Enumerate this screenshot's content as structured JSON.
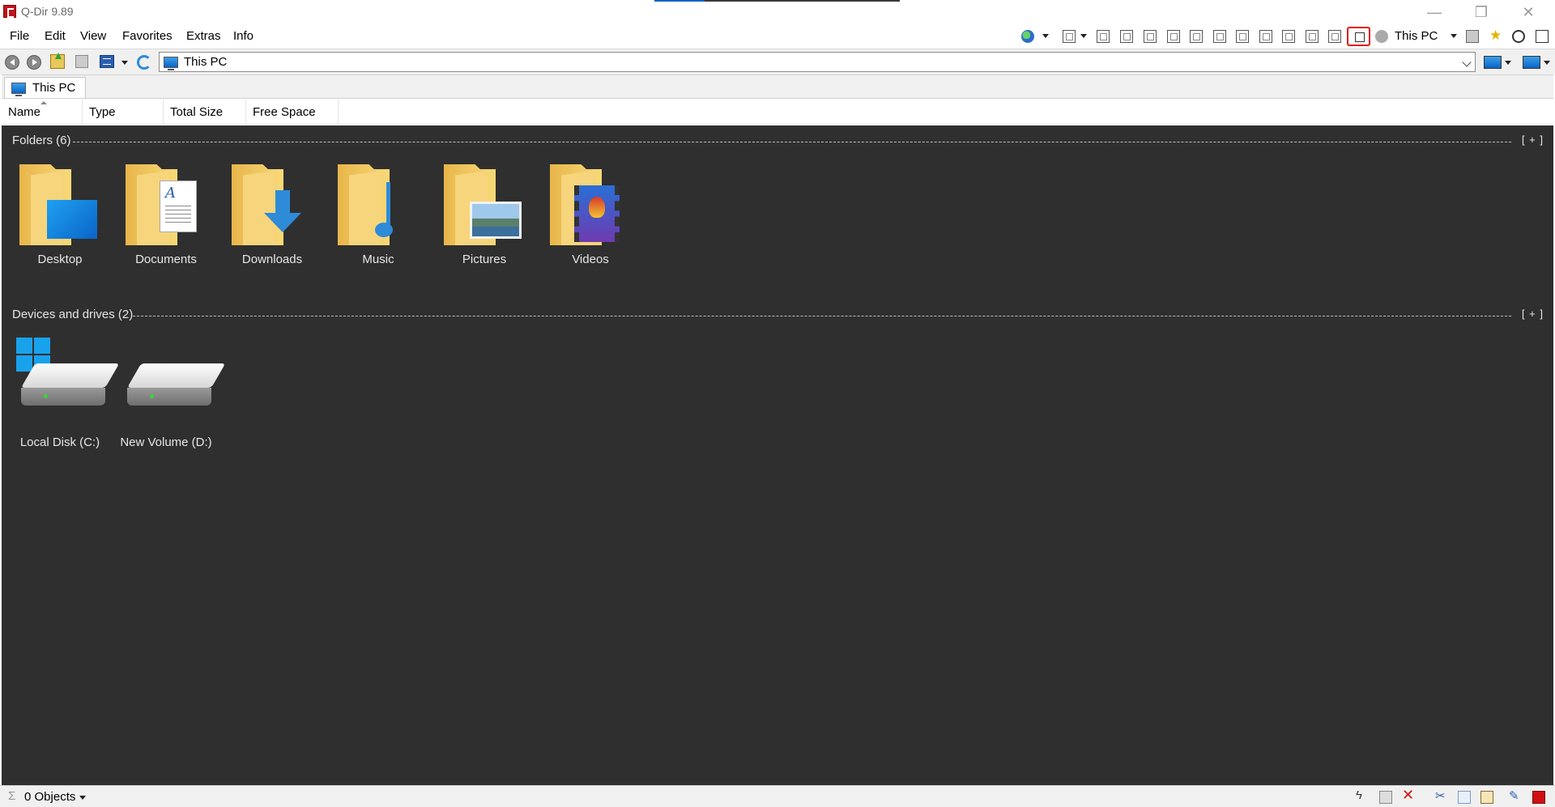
{
  "window": {
    "title": "Q-Dir 9.89",
    "minimize_glyph": "—",
    "restore_glyph": "❐",
    "close_glyph": "✕"
  },
  "menu": {
    "items": [
      "File",
      "Edit",
      "View",
      "Favorites",
      "Extras",
      "Info"
    ]
  },
  "toolbar": {
    "location_label": "This PC"
  },
  "address_bar": {
    "path": "This PC"
  },
  "tabs": [
    {
      "label": "This PC",
      "active": true
    }
  ],
  "columns": [
    "Name",
    "Type",
    "Total Size",
    "Free Space"
  ],
  "groups": {
    "folders": {
      "title": "Folders (6)",
      "expand_label": "[ + ]",
      "items": [
        {
          "label": "Desktop",
          "icon": "desktop-folder-icon"
        },
        {
          "label": "Documents",
          "icon": "documents-folder-icon"
        },
        {
          "label": "Downloads",
          "icon": "downloads-folder-icon"
        },
        {
          "label": "Music",
          "icon": "music-folder-icon"
        },
        {
          "label": "Pictures",
          "icon": "pictures-folder-icon"
        },
        {
          "label": "Videos",
          "icon": "videos-folder-icon"
        }
      ]
    },
    "drives": {
      "title": "Devices and drives (2)",
      "expand_label": "[ + ]",
      "items": [
        {
          "label": "Local Disk (C:)",
          "icon": "system-drive-icon"
        },
        {
          "label": "New Volume (D:)",
          "icon": "drive-icon"
        }
      ]
    }
  },
  "status": {
    "sigma": "Σ",
    "objects": "0 Objects"
  },
  "colors": {
    "content_bg": "#2f2f2f",
    "highlight": "#e0161a",
    "accent": "#0a64c8"
  }
}
